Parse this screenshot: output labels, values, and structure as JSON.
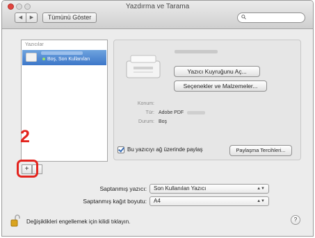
{
  "window": {
    "title": "Yazdırma ve Tarama"
  },
  "toolbar": {
    "back_label": "◀",
    "forward_label": "▶",
    "show_all_label": "Tümünü Göster",
    "search_placeholder": ""
  },
  "printers": {
    "header": "Yazıcılar",
    "items": [
      {
        "status": "Boş, Son Kullanılan"
      }
    ]
  },
  "annotation": {
    "step": "2"
  },
  "list_controls": {
    "add_label": "+",
    "remove_label": "-"
  },
  "details": {
    "queue_button": "Yazıcı Kuyruğunu Aç...",
    "options_button": "Seçenekler ve Malzemeler...",
    "location_label": "Konum:",
    "location_value": "",
    "type_label": "Tür:",
    "type_value": "Adobe PDF",
    "status_label": "Durum:",
    "status_value": "Boş",
    "share_label": "Bu yazıcıyı ağ üzerinde paylaş",
    "share_checked": true,
    "sharing_prefs_button": "Paylaşma Tercihleri..."
  },
  "defaults": {
    "printer_label": "Saptanmış yazıcı:",
    "printer_value": "Son Kullanılan Yazıcı",
    "paper_label": "Saptanmış kağıt boyutu:",
    "paper_value": "A4"
  },
  "footer": {
    "lock_text": "Değişiklikleri engellemek için kilidi tıklayın.",
    "help_label": "?"
  },
  "colors": {
    "accent": "#e3241e",
    "selection": "#3d77c9"
  }
}
